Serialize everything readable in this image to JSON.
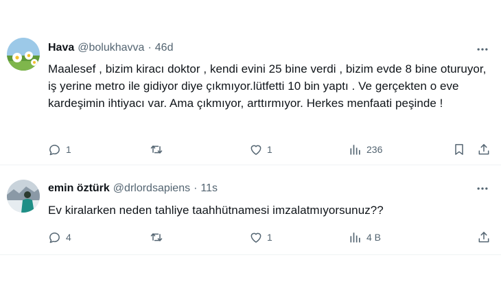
{
  "tweets": [
    {
      "name": "Hava",
      "handle": "@bolukhavva",
      "separator": "·",
      "time": "46d",
      "text": "Maalesef , bizim kiracı doktor , kendi evini  25 bine verdi , bizim evde 8 bine oturuyor, iş yerine metro ile gidiyor diye çıkmıyor.lütfetti 10 bin yaptı . Ve gerçekten o eve kardeşimin ihtiyacı var. Ama çıkmıyor, arttırmıyor. Herkes menfaati peşinde !",
      "replies": "1",
      "retweets": "",
      "likes": "1",
      "views": "236"
    },
    {
      "name": "emin öztürk",
      "handle": "@drlordsapiens",
      "separator": "·",
      "time": "11s",
      "text": "Ev kiralarken neden tahliye taahhütnamesi imzalatmıyorsunuz??",
      "replies": "4",
      "retweets": "",
      "likes": "1",
      "views": "4 B"
    }
  ],
  "icons": {
    "more": "more-horizontal-icon",
    "reply": "reply-bubble-icon",
    "retweet": "retweet-icon",
    "like": "heart-icon",
    "views": "bar-chart-icon",
    "bookmark": "bookmark-icon",
    "share": "share-upload-icon"
  },
  "colors": {
    "text": "#0f1419",
    "secondary": "#536471",
    "divider": "#eff3f4",
    "background": "#ffffff"
  }
}
